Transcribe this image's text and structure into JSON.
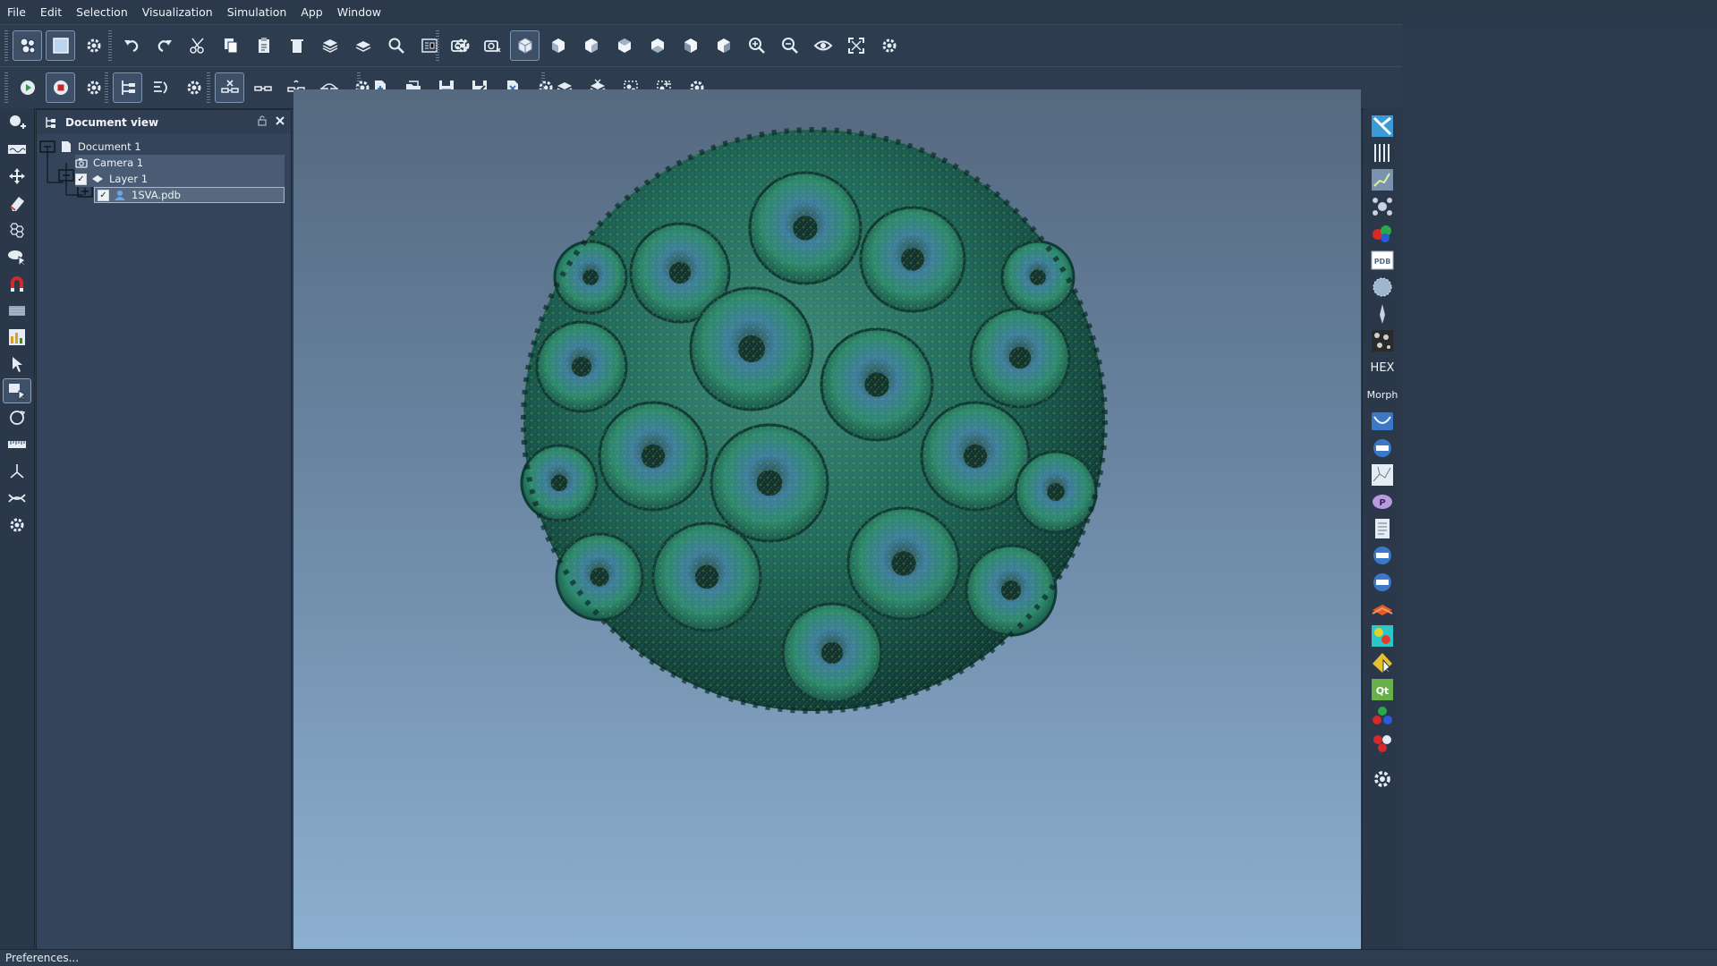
{
  "menubar": {
    "items": [
      "File",
      "Edit",
      "Selection",
      "Visualization",
      "Simulation",
      "App",
      "Window"
    ]
  },
  "document_view": {
    "title": "Document view",
    "tree": {
      "document": "Document 1",
      "camera": "Camera 1",
      "layer": "Layer 1",
      "structure": "1SVA.pdb"
    }
  },
  "right_toolbar": {
    "hex_label": "HEX",
    "morph_label": "Morph",
    "pdb_label": "PDB"
  },
  "status": {
    "text": "Preferences..."
  },
  "colors": {
    "background": "#2b3a4e",
    "viewport_top": "#55697f",
    "viewport_bottom": "#8db0d0",
    "virus_primary": "#1f6a5a",
    "virus_secondary": "#3a6fa0"
  }
}
